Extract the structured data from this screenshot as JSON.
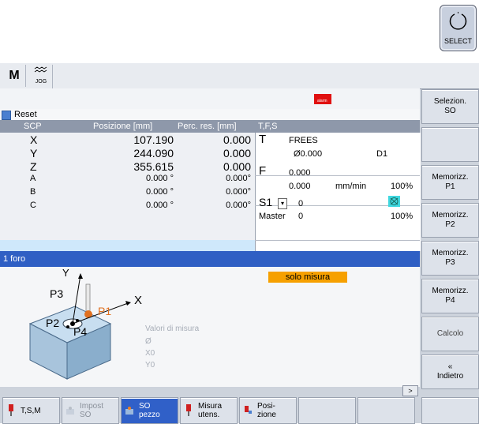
{
  "select_key": {
    "label": "SELECT"
  },
  "header": {
    "mode_m": "M",
    "mode_jog": "JOG"
  },
  "status": {
    "reset_label": "Reset",
    "alarm_text": "alarm"
  },
  "positions": {
    "headers": [
      "SCP",
      "Posizione [mm]",
      "Perc. res. [mm]"
    ],
    "rows": [
      {
        "axis": "X",
        "pos": "107.190",
        "rem": "0.000",
        "big": true
      },
      {
        "axis": "Y",
        "pos": "244.090",
        "rem": "0.000",
        "big": true
      },
      {
        "axis": "Z",
        "pos": "355.615",
        "rem": "0.000",
        "big": true
      },
      {
        "axis": "A",
        "pos": "0.000 °",
        "rem": "0.000°",
        "big": false
      },
      {
        "axis": "B",
        "pos": "0.000 °",
        "rem": "0.000°",
        "big": false
      },
      {
        "axis": "C",
        "pos": "0.000 °",
        "rem": "0.000°",
        "big": false
      }
    ]
  },
  "tfs": {
    "title": "T,F,S",
    "t_label": "T",
    "tool_name": "FREES",
    "tool_diam": "Ø0.000",
    "tool_d": "D1",
    "f_label": "F",
    "f_value1": "0.000",
    "f_value2": "0.000",
    "f_unit": "mm/min",
    "f_pct": "100%",
    "s_label": "S1",
    "s_value": "0",
    "master_label": "Master",
    "master_value": "0",
    "s_pct": "100%"
  },
  "measure": {
    "bar_title": "1 foro",
    "mode_badge": "solo misura",
    "values_title": "Valori di misura",
    "values": [
      "Ø",
      "X0",
      "Y0"
    ],
    "graphic_labels": [
      "Y",
      "X",
      "P1",
      "P2",
      "P3",
      "P4"
    ],
    "scroll": ">"
  },
  "right_softkeys": [
    "Selezion.\nSO",
    "",
    "Memorizz.\nP1",
    "Memorizz.\nP2",
    "Memorizz.\nP3",
    "Memorizz.\nP4",
    "Calcolo",
    "«\nIndietro"
  ],
  "bottom_softkeys": [
    {
      "label": "T,S,M"
    },
    {
      "label": "Impost\nSO"
    },
    {
      "label": "SO\npezzo"
    },
    {
      "label": "Misura\nutens."
    },
    {
      "label": "Posi-\nzione"
    }
  ],
  "colors": {
    "accent_blue": "#2f5fc4",
    "badge_orange": "#f6a000",
    "alarm_red": "#e01010",
    "tool_red": "#d02020"
  }
}
